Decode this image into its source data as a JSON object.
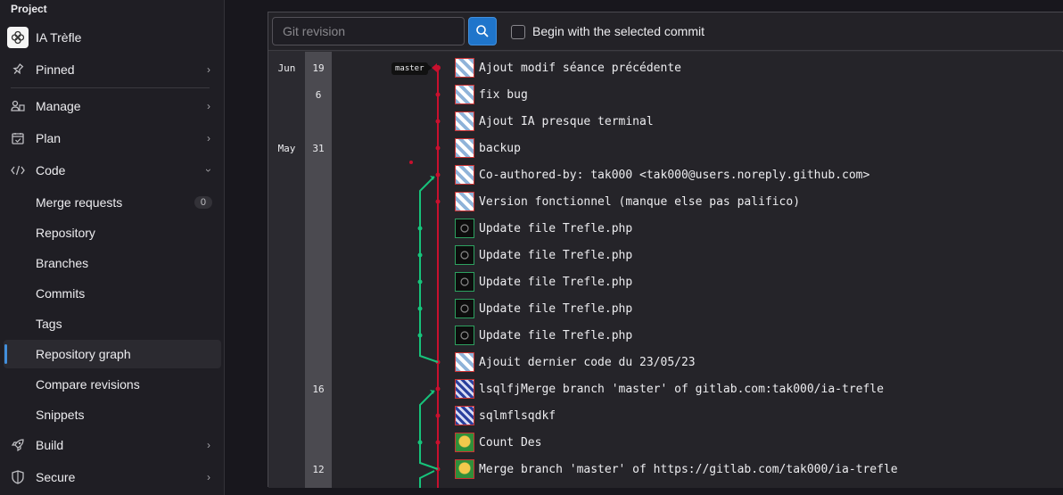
{
  "sidebar": {
    "header": "Project",
    "project_name": "IA Trèfle",
    "items": [
      {
        "label": "Pinned"
      },
      {
        "label": "Manage"
      },
      {
        "label": "Plan"
      },
      {
        "label": "Code"
      },
      {
        "label": "Build"
      },
      {
        "label": "Secure"
      }
    ],
    "code_sub": [
      {
        "label": "Merge requests",
        "badge": "0"
      },
      {
        "label": "Repository"
      },
      {
        "label": "Branches"
      },
      {
        "label": "Commits"
      },
      {
        "label": "Tags"
      },
      {
        "label": "Repository graph",
        "active": true
      },
      {
        "label": "Compare revisions"
      },
      {
        "label": "Snippets"
      }
    ]
  },
  "toolbar": {
    "revision_placeholder": "Git revision",
    "checkbox_label": "Begin with the selected commit"
  },
  "graph": {
    "months": [
      "Jun",
      "May"
    ],
    "days": [
      "19",
      "6",
      "31",
      "16",
      "12"
    ],
    "branch_label": "master",
    "commits": [
      "Ajout modif séance précédente",
      "fix bug",
      "Ajout IA presque terminal",
      "backup",
      "Co-authored-by: tak000 <tak000@users.noreply.github.com>",
      "Version fonctionnel (manque else pas palifico)",
      "Update file Trefle.php",
      "Update file Trefle.php",
      "Update file Trefle.php",
      "Update file Trefle.php",
      "Update file Trefle.php",
      "Ajouit dernier code du 23/05/23",
      "lsqlfjMerge branch 'master' of gitlab.com:tak000/ia-trefle",
      "sqlmflsqdkf",
      "Count Des",
      "Merge branch 'master' of https://gitlab.com/tak000/ia-trefle"
    ],
    "colors": {
      "main": "#c8102e",
      "branch": "#17c37b"
    }
  }
}
